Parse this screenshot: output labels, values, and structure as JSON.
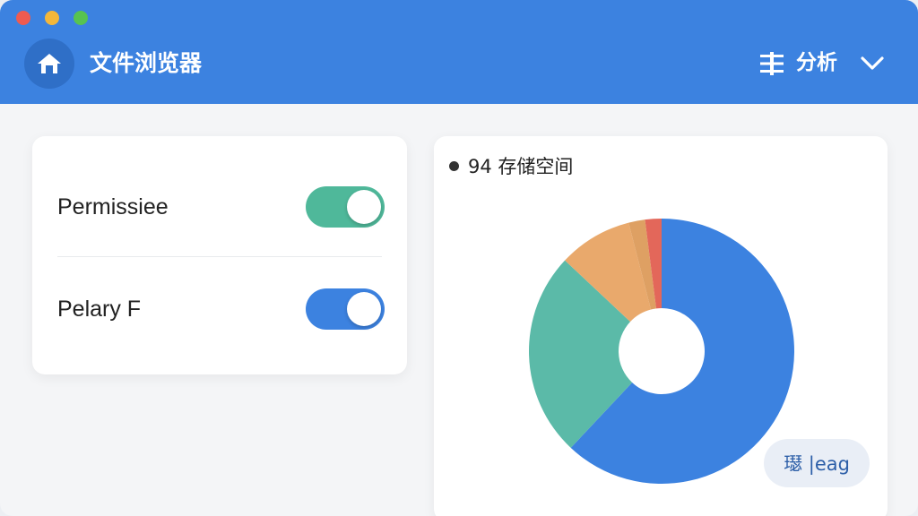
{
  "window": {
    "title": "文件浏览器",
    "menu_label": "分析",
    "icons": {
      "home": "home-icon",
      "filter": "sliders-icon",
      "chevron": "chevron-down-icon"
    },
    "colors": {
      "titlebar": "#3c82e0",
      "accent": "#3c82e0"
    }
  },
  "settings": {
    "items": [
      {
        "label": "Permissiee",
        "on": true,
        "color": "#4fb89a"
      },
      {
        "label": "Pelary F",
        "on": true,
        "color": "#3c82e0"
      }
    ]
  },
  "storage": {
    "title": "94 存储空间",
    "chip_label": "璱 |eag"
  },
  "chart_data": {
    "type": "pie",
    "title": "94 存储空间",
    "slices": [
      {
        "value": 62,
        "color": "#3c82e0"
      },
      {
        "value": 25,
        "color": "#5bbaa8"
      },
      {
        "value": 9,
        "color": "#e9a96c"
      },
      {
        "value": 2,
        "color": "#dea063"
      },
      {
        "value": 2,
        "color": "#e3675a"
      }
    ]
  }
}
